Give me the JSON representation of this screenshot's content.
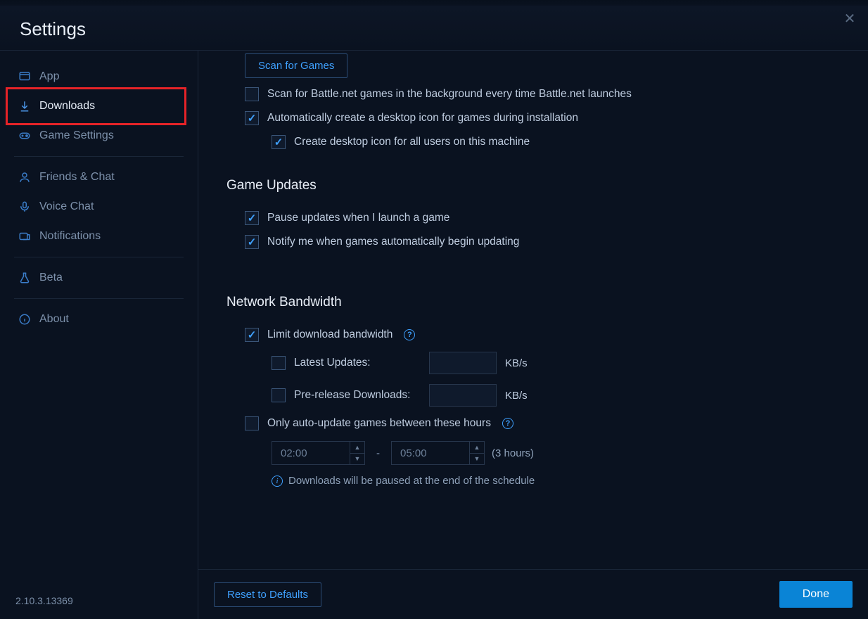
{
  "header": {
    "title": "Settings"
  },
  "sidebar": {
    "items": [
      {
        "label": "App"
      },
      {
        "label": "Downloads"
      },
      {
        "label": "Game Settings"
      },
      {
        "label": "Friends & Chat"
      },
      {
        "label": "Voice Chat"
      },
      {
        "label": "Notifications"
      },
      {
        "label": "Beta"
      },
      {
        "label": "About"
      }
    ],
    "version": "2.10.3.13369"
  },
  "content": {
    "scan_button": "Scan for Games",
    "checks": {
      "scan_bg": "Scan for Battle.net games in the background every time Battle.net launches",
      "auto_icon": "Automatically create a desktop icon for games during installation",
      "icon_all_users": "Create desktop icon for all users on this machine"
    },
    "updates_title": "Game Updates",
    "updates": {
      "pause_launch": "Pause updates when I launch a game",
      "notify_auto": "Notify me when games automatically begin updating"
    },
    "bandwidth_title": "Network Bandwidth",
    "bandwidth": {
      "limit_label": "Limit download bandwidth",
      "latest_label": "Latest Updates:",
      "prerelease_label": "Pre-release Downloads:",
      "unit": "KB/s",
      "latest_value": "",
      "prerelease_value": "",
      "auto_between_label": "Only auto-update games between these hours",
      "time_start": "02:00",
      "time_end": "05:00",
      "duration": "(3 hours)",
      "info": "Downloads will be paused at the end of the schedule"
    }
  },
  "footer": {
    "reset": "Reset to Defaults",
    "done": "Done"
  }
}
